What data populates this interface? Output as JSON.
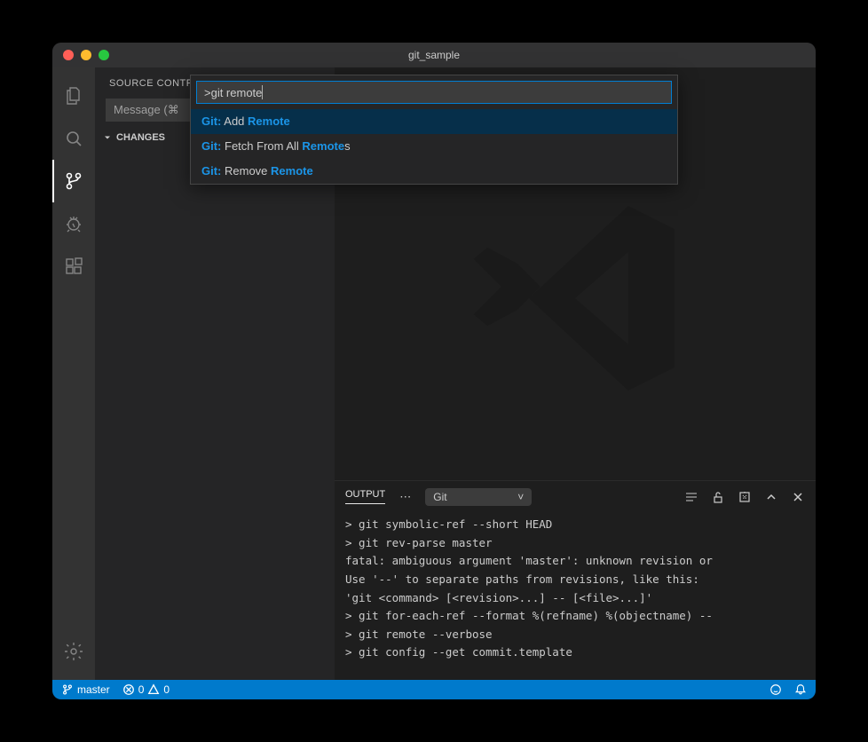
{
  "titlebar": {
    "title": "git_sample"
  },
  "sidebar": {
    "header": "SOURCE CONTROL",
    "commit_placeholder": "Message (⌘",
    "changes_label": "CHANGES"
  },
  "palette": {
    "input": ">git remote",
    "items": [
      {
        "prefix": "Git:",
        "pre": " Add ",
        "hl": "Remote",
        "post": ""
      },
      {
        "prefix": "Git:",
        "pre": " Fetch From All ",
        "hl": "Remote",
        "post": "s"
      },
      {
        "prefix": "Git:",
        "pre": " Remove ",
        "hl": "Remote",
        "post": ""
      }
    ]
  },
  "panel": {
    "tab": "OUTPUT",
    "channel": "Git",
    "lines": [
      "> git symbolic-ref --short HEAD",
      "> git rev-parse master",
      "fatal: ambiguous argument 'master': unknown revision or",
      "Use '--' to separate paths from revisions, like this:",
      "'git <command> [<revision>...] -- [<file>...]'",
      "> git for-each-ref --format %(refname) %(objectname) --",
      "> git remote --verbose",
      "> git config --get commit.template"
    ]
  },
  "statusbar": {
    "branch": "master",
    "errors": "0",
    "warnings": "0"
  }
}
